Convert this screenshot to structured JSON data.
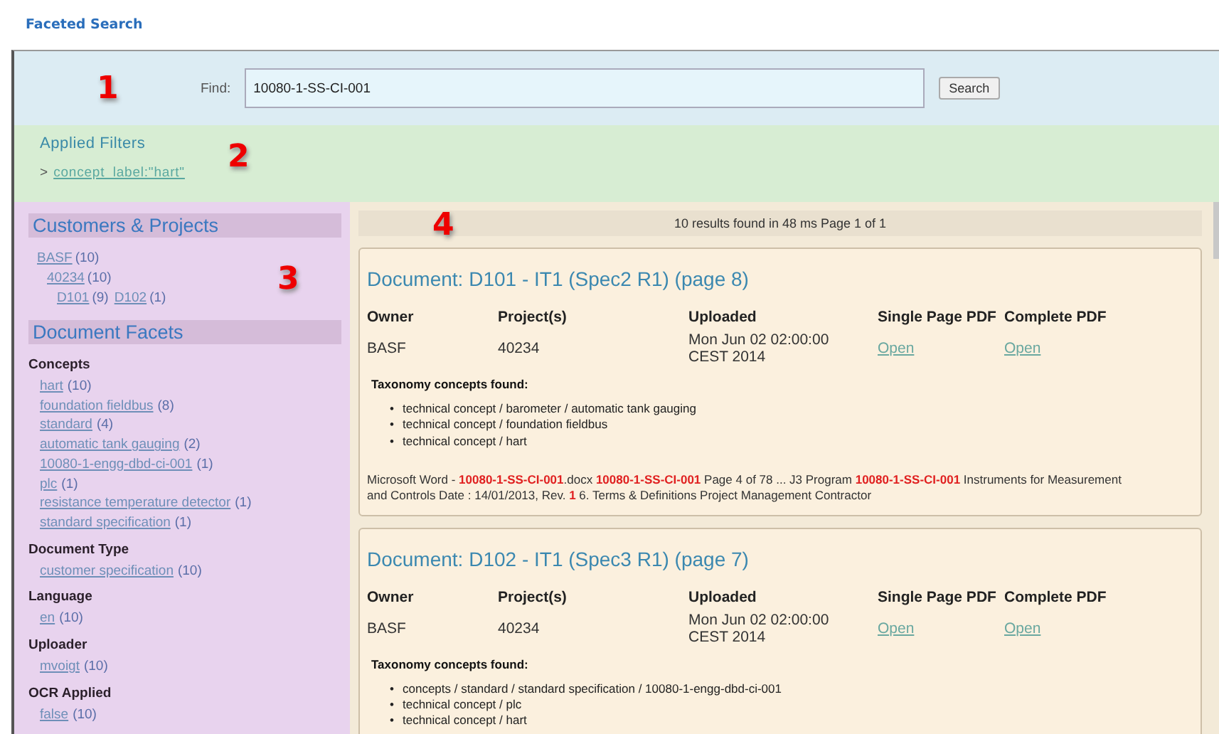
{
  "header": {
    "title": "Faceted Search"
  },
  "search": {
    "label": "Find:",
    "value": "10080-1-SS-CI-001",
    "button": "Search"
  },
  "applied_filters": {
    "title": "Applied Filters",
    "prefix": ">",
    "filters": [
      "concept_label:\"hart\""
    ]
  },
  "markers": [
    "1",
    "2",
    "3",
    "4"
  ],
  "sidebar": {
    "customers_title": "Customers & Projects",
    "tree": [
      {
        "label": "BASF",
        "count": "(10)",
        "children": [
          {
            "label": "40234",
            "count": "(10)",
            "children": [
              {
                "label": "D101",
                "count": "(9)"
              },
              {
                "label": "D102",
                "count": "(1)"
              }
            ]
          }
        ]
      }
    ],
    "facets_title": "Document Facets",
    "facets": [
      {
        "title": "Concepts",
        "items": [
          {
            "label": "hart",
            "count": "(10)"
          },
          {
            "label": "foundation fieldbus",
            "count": "(8)"
          },
          {
            "label": "standard",
            "count": "(4)"
          },
          {
            "label": "automatic tank gauging",
            "count": "(2)"
          },
          {
            "label": "10080-1-engg-dbd-ci-001",
            "count": "(1)"
          },
          {
            "label": "plc",
            "count": "(1)"
          },
          {
            "label": "resistance temperature detector",
            "count": "(1)"
          },
          {
            "label": "standard specification",
            "count": "(1)"
          }
        ]
      },
      {
        "title": "Document Type",
        "items": [
          {
            "label": "customer specification",
            "count": "(10)"
          }
        ]
      },
      {
        "title": "Language",
        "items": [
          {
            "label": "en",
            "count": "(10)"
          }
        ]
      },
      {
        "title": "Uploader",
        "items": [
          {
            "label": "mvoigt",
            "count": "(10)"
          }
        ]
      },
      {
        "title": "OCR Applied",
        "items": [
          {
            "label": "false",
            "count": "(10)"
          }
        ]
      }
    ]
  },
  "results": {
    "summary": "10 results found in 48 ms Page 1 of 1",
    "documents": [
      {
        "title": "Document: D101 - IT1 (Spec2 R1) (page 8)",
        "columns": [
          "Owner",
          "Project(s)",
          "Uploaded",
          "Single Page PDF",
          "Complete PDF"
        ],
        "owner": "BASF",
        "project": "40234",
        "uploaded": [
          "Mon Jun 02 02:00:00",
          "CEST 2014"
        ],
        "single_pdf": "Open",
        "complete_pdf": "Open",
        "taxonomy_title": "Taxonomy concepts found:",
        "concepts": [
          {
            "marker": "•",
            "text": "technical concept / barometer / automatic tank gauging"
          },
          {
            "marker": "•",
            "text": "technical concept / foundation fieldbus"
          },
          {
            "marker": "•",
            "text": "technical concept / hart"
          }
        ],
        "snippet": "Microsoft Word - **10080-1-SS-CI-001**.docx **10080-1-SS-CI-001** Page 4 of 78 ... J3 Program **10080-1-SS-CI-001** Instruments for Measurement and Controls Date : 14/01/2013, Rev. **1** 6. Terms & Definitions Project Management Contractor"
      },
      {
        "title": "Document: D102 - IT1 (Spec3 R1) (page 7)",
        "columns": [
          "Owner",
          "Project(s)",
          "Uploaded",
          "Single Page PDF",
          "Complete PDF"
        ],
        "owner": "BASF",
        "project": "40234",
        "uploaded": [
          "Mon Jun 02 02:00:00",
          "CEST 2014"
        ],
        "single_pdf": "Open",
        "complete_pdf": "Open",
        "taxonomy_title": "Taxonomy concepts found:",
        "concepts": [
          {
            "marker": "•",
            "text": "concepts / standard / standard specification / 10080-1-engg-dbd-ci-001"
          },
          {
            "marker": "•",
            "text": "technical concept / plc"
          },
          {
            "marker": "•",
            "text": "technical concept / hart"
          }
        ]
      }
    ]
  }
}
